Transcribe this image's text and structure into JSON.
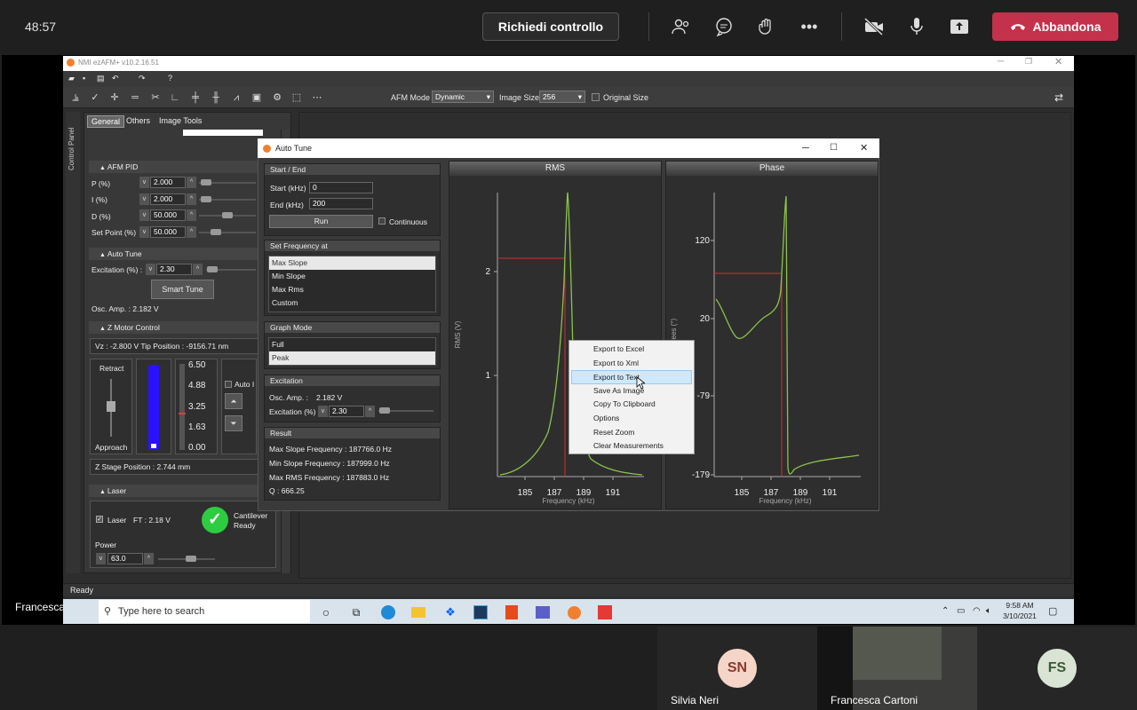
{
  "teams": {
    "timer": "48:57",
    "request_control": "Richiedi controllo",
    "leave": "Abbandona",
    "presenter_name": "Francesca Cartoni"
  },
  "app": {
    "title": "NMI ezAFM+ v10.2.16.51",
    "afm_mode_label": "AFM Mode",
    "afm_mode_value": "Dynamic",
    "image_size_label": "Image Size",
    "image_size_value": "256",
    "original_size_label": "Original Size",
    "status": "Ready"
  },
  "control_panel": {
    "side_label": "Control Panel",
    "tabs": [
      "General",
      "Others",
      "Image Tools"
    ],
    "afm_pid": {
      "header": "AFM PID",
      "rows": [
        {
          "label": "P (%)",
          "value": "2.000"
        },
        {
          "label": "I (%)",
          "value": "2.000"
        },
        {
          "label": "D (%)",
          "value": "50.000"
        },
        {
          "label": "Set Point (%)",
          "value": "50.000"
        }
      ]
    },
    "auto_tune": {
      "header": "Auto Tune",
      "excitation_label": "Excitation (%) :",
      "excitation_value": "2.30",
      "smart_tune": "Smart Tune",
      "osc_amp": "Osc. Amp. : 2.182 V"
    },
    "z_motor": {
      "header": "Z Motor Control",
      "readout": "Vz :   -2.800 V  Tip Position :  -9156.71 nm",
      "retract": "Retract",
      "approach": "Approach",
      "scale": [
        "6.50",
        "4.88",
        "3.25",
        "1.63",
        "0.00"
      ],
      "auto_label": "Auto I",
      "z_stage": "Z Stage Position : 2.744 mm"
    },
    "laser": {
      "header": "Laser",
      "laser_label": "Laser",
      "ft": "FT : 2.18 V",
      "cantilever": "Cantilever",
      "ready": "Ready",
      "power_label": "Power",
      "power_value": "63.0"
    }
  },
  "auto_tune_dialog": {
    "title": "Auto Tune",
    "start_end": {
      "header": "Start / End",
      "start_label": "Start (kHz)",
      "start_value": "0",
      "end_label": "End (kHz)",
      "end_value": "200",
      "run": "Run",
      "continuous": "Continuous"
    },
    "set_frequency": {
      "header": "Set Frequency at",
      "items": [
        "Max Slope",
        "Min Slope",
        "Max Rms",
        "Custom"
      ],
      "selected": 0
    },
    "graph_mode": {
      "header": "Graph Mode",
      "items": [
        "Full",
        "Peak"
      ],
      "selected": 1
    },
    "excitation": {
      "header": "Excitation",
      "osc_amp_label": "Osc. Amp. :",
      "osc_amp_value": "2.182  V",
      "excitation_label": "Excitation (%)",
      "excitation_value": "2.30"
    },
    "result": {
      "header": "Result",
      "lines": [
        "Max Slope Frequency : 187766.0 Hz",
        "Min Slope Frequency : 187999.0 Hz",
        "Max RMS Frequency : 187883.0 Hz",
        "Q : 666.25"
      ]
    },
    "rms_chart": {
      "title": "RMS",
      "ylabel": "RMS (V)",
      "xlabel": "Frequency (kHz)",
      "xticks": [
        "185",
        "187",
        "189",
        "191"
      ],
      "yticks": [
        "2",
        "1"
      ]
    },
    "phase_chart": {
      "title": "Phase",
      "ylabel": "rees (°)",
      "xlabel": "Frequency (kHz)",
      "xticks": [
        "185",
        "187",
        "189",
        "191"
      ],
      "yticks": [
        "120",
        "20",
        "-79",
        "-179"
      ]
    }
  },
  "context_menu": {
    "items": [
      "Export to Excel",
      "Export to Xml",
      "Export to Text",
      "Save As Image",
      "Copy To Clipboard",
      "Options",
      "Reset Zoom",
      "Clear Measurements"
    ],
    "highlighted": 2
  },
  "taskbar": {
    "search_placeholder": "Type here to search",
    "time": "9:58 AM",
    "date": "3/10/2021"
  },
  "participants": [
    {
      "initials": "SN",
      "name": "Silvia Neri"
    },
    {
      "initials": "",
      "name": "Francesca Cartoni"
    },
    {
      "initials": "FS",
      "name": ""
    }
  ],
  "colors": {
    "leave": "#c4314b",
    "curve": "#8bc34a",
    "marker": "#d32f2f",
    "z_bar": "#2a12ff",
    "ready_check": "#2ecc40"
  }
}
